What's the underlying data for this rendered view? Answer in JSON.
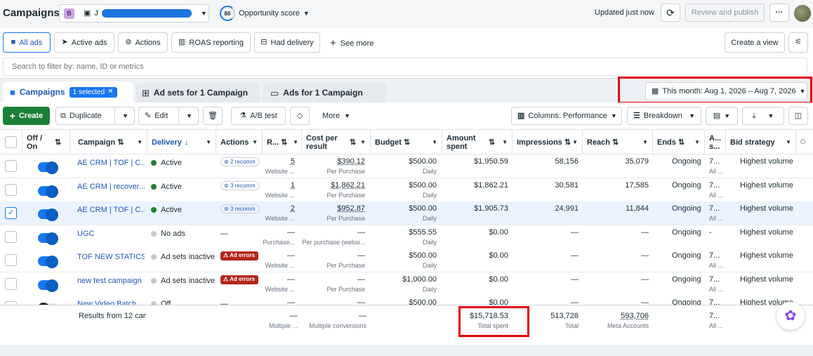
{
  "topbar": {
    "title": "Campaigns",
    "account_badge": "B",
    "account_name": "J",
    "score_value": "86",
    "score_label": "Opportunity score",
    "updated_text": "Updated just now",
    "review_publish_label": "Review and publish",
    "more_label": "···"
  },
  "filters": {
    "tabs": [
      {
        "label": "All ads",
        "icon": "folder-icon"
      },
      {
        "label": "Active ads",
        "icon": "send-icon"
      },
      {
        "label": "Actions",
        "icon": "circle-arrow-icon"
      },
      {
        "label": "ROAS reporting",
        "icon": "chart-icon"
      },
      {
        "label": "Had delivery",
        "icon": "inbox-icon"
      }
    ],
    "see_more_label": "See more",
    "create_view_label": "Create a view",
    "search_placeholder": "Search to filter by: name, ID or metrics"
  },
  "level_tabs": {
    "campaigns_label": "Campaigns",
    "selected_label": "1 selected",
    "adsets_label": "Ad sets for 1 Campaign",
    "ads_label": "Ads for 1 Campaign"
  },
  "date_range": "This month: Aug 1, 2026 – Aug 7, 2026",
  "toolbar": {
    "create_label": "Create",
    "duplicate_label": "Duplicate",
    "edit_label": "Edit",
    "ab_test_label": "A/B test",
    "more_label": "More",
    "columns_label": "Columns: Performance",
    "breakdown_label": "Breakdown"
  },
  "table": {
    "headers": {
      "off_on": "Off / On",
      "campaign": "Campaign",
      "delivery": "Delivery",
      "actions": "Actions",
      "results": "R...",
      "cost_per_result": "Cost per result",
      "budget": "Budget",
      "amount_spent": "Amount spent",
      "impressions": "Impressions",
      "reach": "Reach",
      "ends": "Ends",
      "attribution": "A... s...",
      "bid_strategy": "Bid strategy"
    },
    "rows": [
      {
        "checked": false,
        "toggle": "on",
        "campaign": "AE CRM | TOF | C...",
        "status_color": "#1e7e34",
        "delivery": "Active",
        "action_type": "recommendation",
        "action": "2 recomm",
        "results": "5",
        "results_sub": "Website ...",
        "cpr": "$390.12",
        "cpr_sub": "Per Purchase",
        "budget": "$500.00",
        "budget_sub": "Daily",
        "spent": "$1,950.59",
        "impressions": "58,156",
        "reach": "35,079",
        "ends": "Ongoing",
        "attr": "7...",
        "attr_sub": "All ...",
        "bid": "Highest volume"
      },
      {
        "checked": false,
        "toggle": "on",
        "campaign": "AE CRM | recover...",
        "status_color": "#1e7e34",
        "delivery": "Active",
        "action_type": "recommendation",
        "action": "3 recomm",
        "results": "1",
        "results_sub": "Website ...",
        "cpr": "$1,862.21",
        "cpr_sub": "Per Purchase",
        "budget": "$500.00",
        "budget_sub": "Daily",
        "spent": "$1,862.21",
        "impressions": "30,581",
        "reach": "17,585",
        "ends": "Ongoing",
        "attr": "7...",
        "attr_sub": "All ...",
        "bid": "Highest volume"
      },
      {
        "checked": true,
        "toggle": "on",
        "campaign": "AE CRM | TOF | C...",
        "status_color": "#1e7e34",
        "delivery": "Active",
        "action_type": "recommendation",
        "action": "3 recomm",
        "results": "2",
        "results_sub": "Website ...",
        "cpr": "$952.87",
        "cpr_sub": "Per Purchase",
        "budget": "$500.00",
        "budget_sub": "Daily",
        "spent": "$1,905.73",
        "impressions": "24,991",
        "reach": "11,844",
        "ends": "Ongoing",
        "attr": "7...",
        "attr_sub": "All ...",
        "bid": "Highest volume"
      },
      {
        "checked": false,
        "toggle": "on",
        "campaign": "UGC",
        "status_color": "#c4c9cf",
        "delivery": "No ads",
        "action_type": "none",
        "action": "—",
        "results": "—",
        "results_sub": "Purchase...",
        "cpr": "—",
        "cpr_sub": "Per purchase (websi...",
        "budget": "$555.55",
        "budget_sub": "Daily",
        "spent": "$0.00",
        "impressions": "—",
        "reach": "—",
        "ends": "Ongoing",
        "attr": "-",
        "attr_sub": "",
        "bid": "Highest volume"
      },
      {
        "checked": false,
        "toggle": "on",
        "campaign": "TOF NEW STATICS",
        "status_color": "#c4c9cf",
        "delivery": "Ad sets inactive",
        "action_type": "error",
        "action": "Ad errors",
        "results": "—",
        "results_sub": "Website ...",
        "cpr": "—",
        "cpr_sub": "Per Purchase",
        "budget": "$500.00",
        "budget_sub": "Daily",
        "spent": "$0.00",
        "impressions": "—",
        "reach": "—",
        "ends": "Ongoing",
        "attr": "7...",
        "attr_sub": "All ...",
        "bid": "Highest volume"
      },
      {
        "checked": false,
        "toggle": "on",
        "campaign": "new test campaign",
        "status_color": "#c4c9cf",
        "delivery": "Ad sets inactive",
        "action_type": "error",
        "action": "Ad errors",
        "results": "—",
        "results_sub": "Website ...",
        "cpr": "—",
        "cpr_sub": "Per Purchase",
        "budget": "$1,000.00",
        "budget_sub": "Daily",
        "spent": "$0.00",
        "impressions": "—",
        "reach": "—",
        "ends": "Ongoing",
        "attr": "7...",
        "attr_sub": "All ...",
        "bid": "Highest volume"
      },
      {
        "checked": false,
        "toggle": "off",
        "campaign": "New Video Batch",
        "status_color": "#c4c9cf",
        "delivery": "Off",
        "action_type": "none",
        "action": "—",
        "results": "—",
        "results_sub": "",
        "cpr": "—",
        "cpr_sub": "",
        "budget": "$500.00",
        "budget_sub": "",
        "spent": "$0.00",
        "impressions": "—",
        "reach": "—",
        "ends": "Ongoing",
        "attr": "7...",
        "attr_sub": "",
        "bid": "Highest volume"
      }
    ],
    "summary": {
      "label": "Results from 12 cam",
      "results_sub": "Multiple ...",
      "results": "—",
      "cpr": "—",
      "cpr_sub": "Multiple conversions",
      "spent": "$15,718.53",
      "spent_sub": "Total spent",
      "impressions": "513,728",
      "impressions_sub": "Total",
      "reach": "593,706",
      "reach_sub": "Meta Accounts",
      "attr": "7...",
      "attr_sub": "All ..."
    }
  },
  "colors": {
    "accent": "#1877f2",
    "link": "#1e58b8",
    "create_green": "#1a7f37",
    "error_red": "#b3261e",
    "highlight_red": "#e3000b"
  }
}
